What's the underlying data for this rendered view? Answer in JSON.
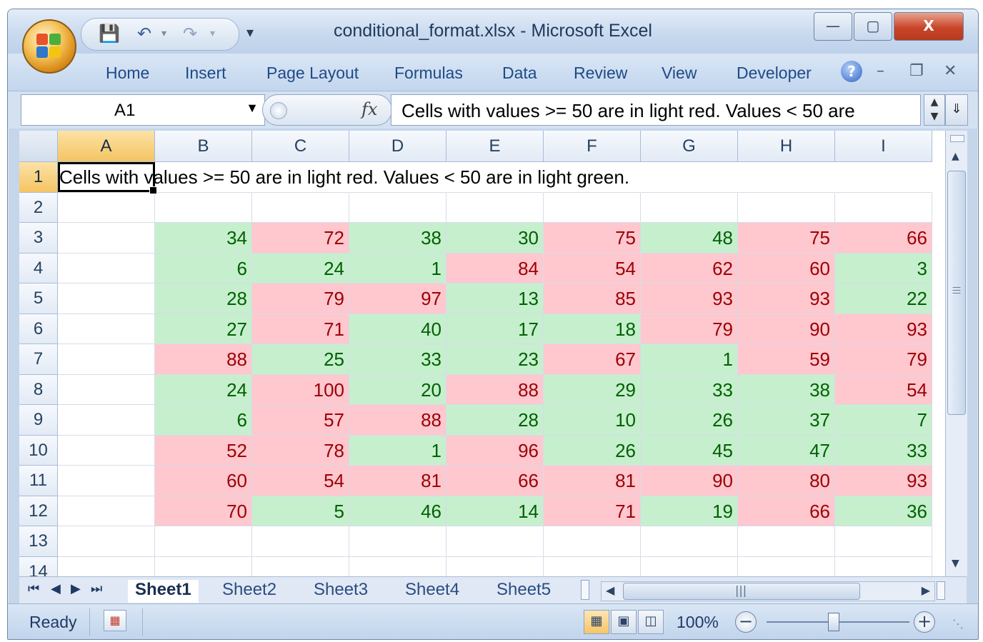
{
  "window": {
    "title": "conditional_format.xlsx - Microsoft Excel",
    "minimize": "—",
    "maximize": "▢",
    "close": "X"
  },
  "quick_access": {
    "save_icon": "save-icon",
    "undo_icon": "undo-icon",
    "redo_icon": "redo-icon",
    "more": "▾"
  },
  "ribbon": {
    "tabs": [
      "Home",
      "Insert",
      "Page Layout",
      "Formulas",
      "Data",
      "Review",
      "View",
      "Developer"
    ]
  },
  "formula_bar": {
    "name_box": "A1",
    "fx_label": "fx",
    "content": "Cells with values >= 50 are in light red. Values < 50 are"
  },
  "grid": {
    "columns": [
      "A",
      "B",
      "C",
      "D",
      "E",
      "F",
      "G",
      "H",
      "I"
    ],
    "rows": [
      "1",
      "2",
      "3",
      "4",
      "5",
      "6",
      "7",
      "8",
      "9",
      "10",
      "11",
      "12",
      "13",
      "14"
    ],
    "a1_text": "Cells with values >= 50 are in light red. Values < 50 are in light green.",
    "threshold": 50,
    "colors": {
      "high_fill": "#ffc7ce",
      "high_text": "#9c0006",
      "low_fill": "#c6efce",
      "low_text": "#006100"
    },
    "values": [
      [
        34,
        72,
        38,
        30,
        75,
        48,
        75,
        66
      ],
      [
        6,
        24,
        1,
        84,
        54,
        62,
        60,
        3
      ],
      [
        28,
        79,
        97,
        13,
        85,
        93,
        93,
        22
      ],
      [
        27,
        71,
        40,
        17,
        18,
        79,
        90,
        93
      ],
      [
        88,
        25,
        33,
        23,
        67,
        1,
        59,
        79
      ],
      [
        24,
        100,
        20,
        88,
        29,
        33,
        38,
        54
      ],
      [
        6,
        57,
        88,
        28,
        10,
        26,
        37,
        7
      ],
      [
        52,
        78,
        1,
        96,
        26,
        45,
        47,
        33
      ],
      [
        60,
        54,
        81,
        66,
        81,
        90,
        80,
        93
      ],
      [
        70,
        5,
        46,
        14,
        71,
        19,
        66,
        36
      ]
    ]
  },
  "sheets": {
    "tabs": [
      "Sheet1",
      "Sheet2",
      "Sheet3",
      "Sheet4",
      "Sheet5"
    ],
    "active": "Sheet1"
  },
  "status": {
    "text": "Ready",
    "zoom": "100%",
    "zoom_out": "−",
    "zoom_in": "+"
  }
}
